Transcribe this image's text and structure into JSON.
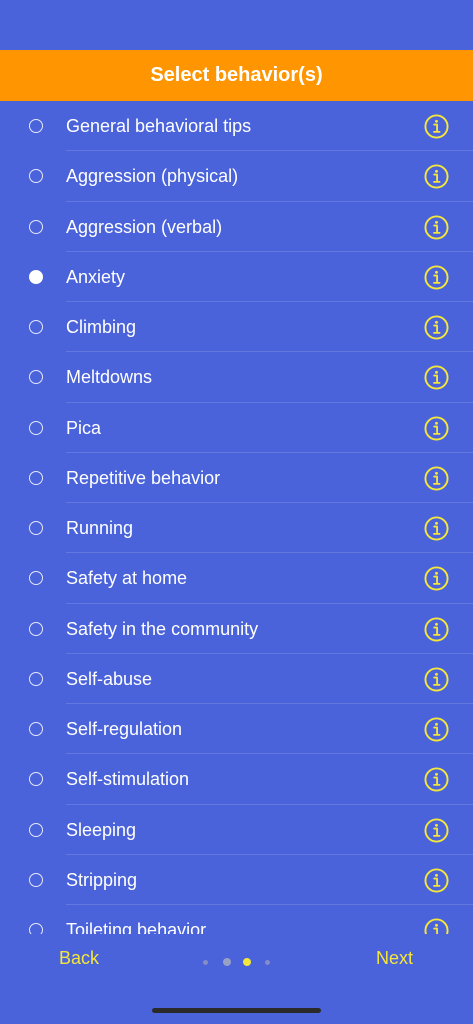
{
  "header": {
    "title": "Select behavior(s)"
  },
  "items": [
    {
      "label": " General behavioral tips",
      "selected": false
    },
    {
      "label": "Aggression (physical)",
      "selected": false
    },
    {
      "label": "Aggression (verbal)",
      "selected": false
    },
    {
      "label": "Anxiety",
      "selected": true
    },
    {
      "label": "Climbing",
      "selected": false
    },
    {
      "label": "Meltdowns",
      "selected": false
    },
    {
      "label": "Pica",
      "selected": false
    },
    {
      "label": "Repetitive behavior",
      "selected": false
    },
    {
      "label": "Running",
      "selected": false
    },
    {
      "label": "Safety at home",
      "selected": false
    },
    {
      "label": "Safety in the community",
      "selected": false
    },
    {
      "label": "Self-abuse",
      "selected": false
    },
    {
      "label": "Self-regulation",
      "selected": false
    },
    {
      "label": "Self-stimulation",
      "selected": false
    },
    {
      "label": "Sleeping",
      "selected": false
    },
    {
      "label": "Stripping",
      "selected": false
    },
    {
      "label": "Toileting behavior",
      "selected": false
    }
  ],
  "footer": {
    "back_label": "Back",
    "next_label": "Next"
  },
  "pager": {
    "pages": 4,
    "current": 3
  },
  "colors": {
    "background": "#4A63DA",
    "header": "#FF9500",
    "accent": "#F5E63A",
    "text": "#FFFFFF"
  },
  "icons": {
    "info": "info-circle-icon",
    "radio": "radio-icon"
  }
}
